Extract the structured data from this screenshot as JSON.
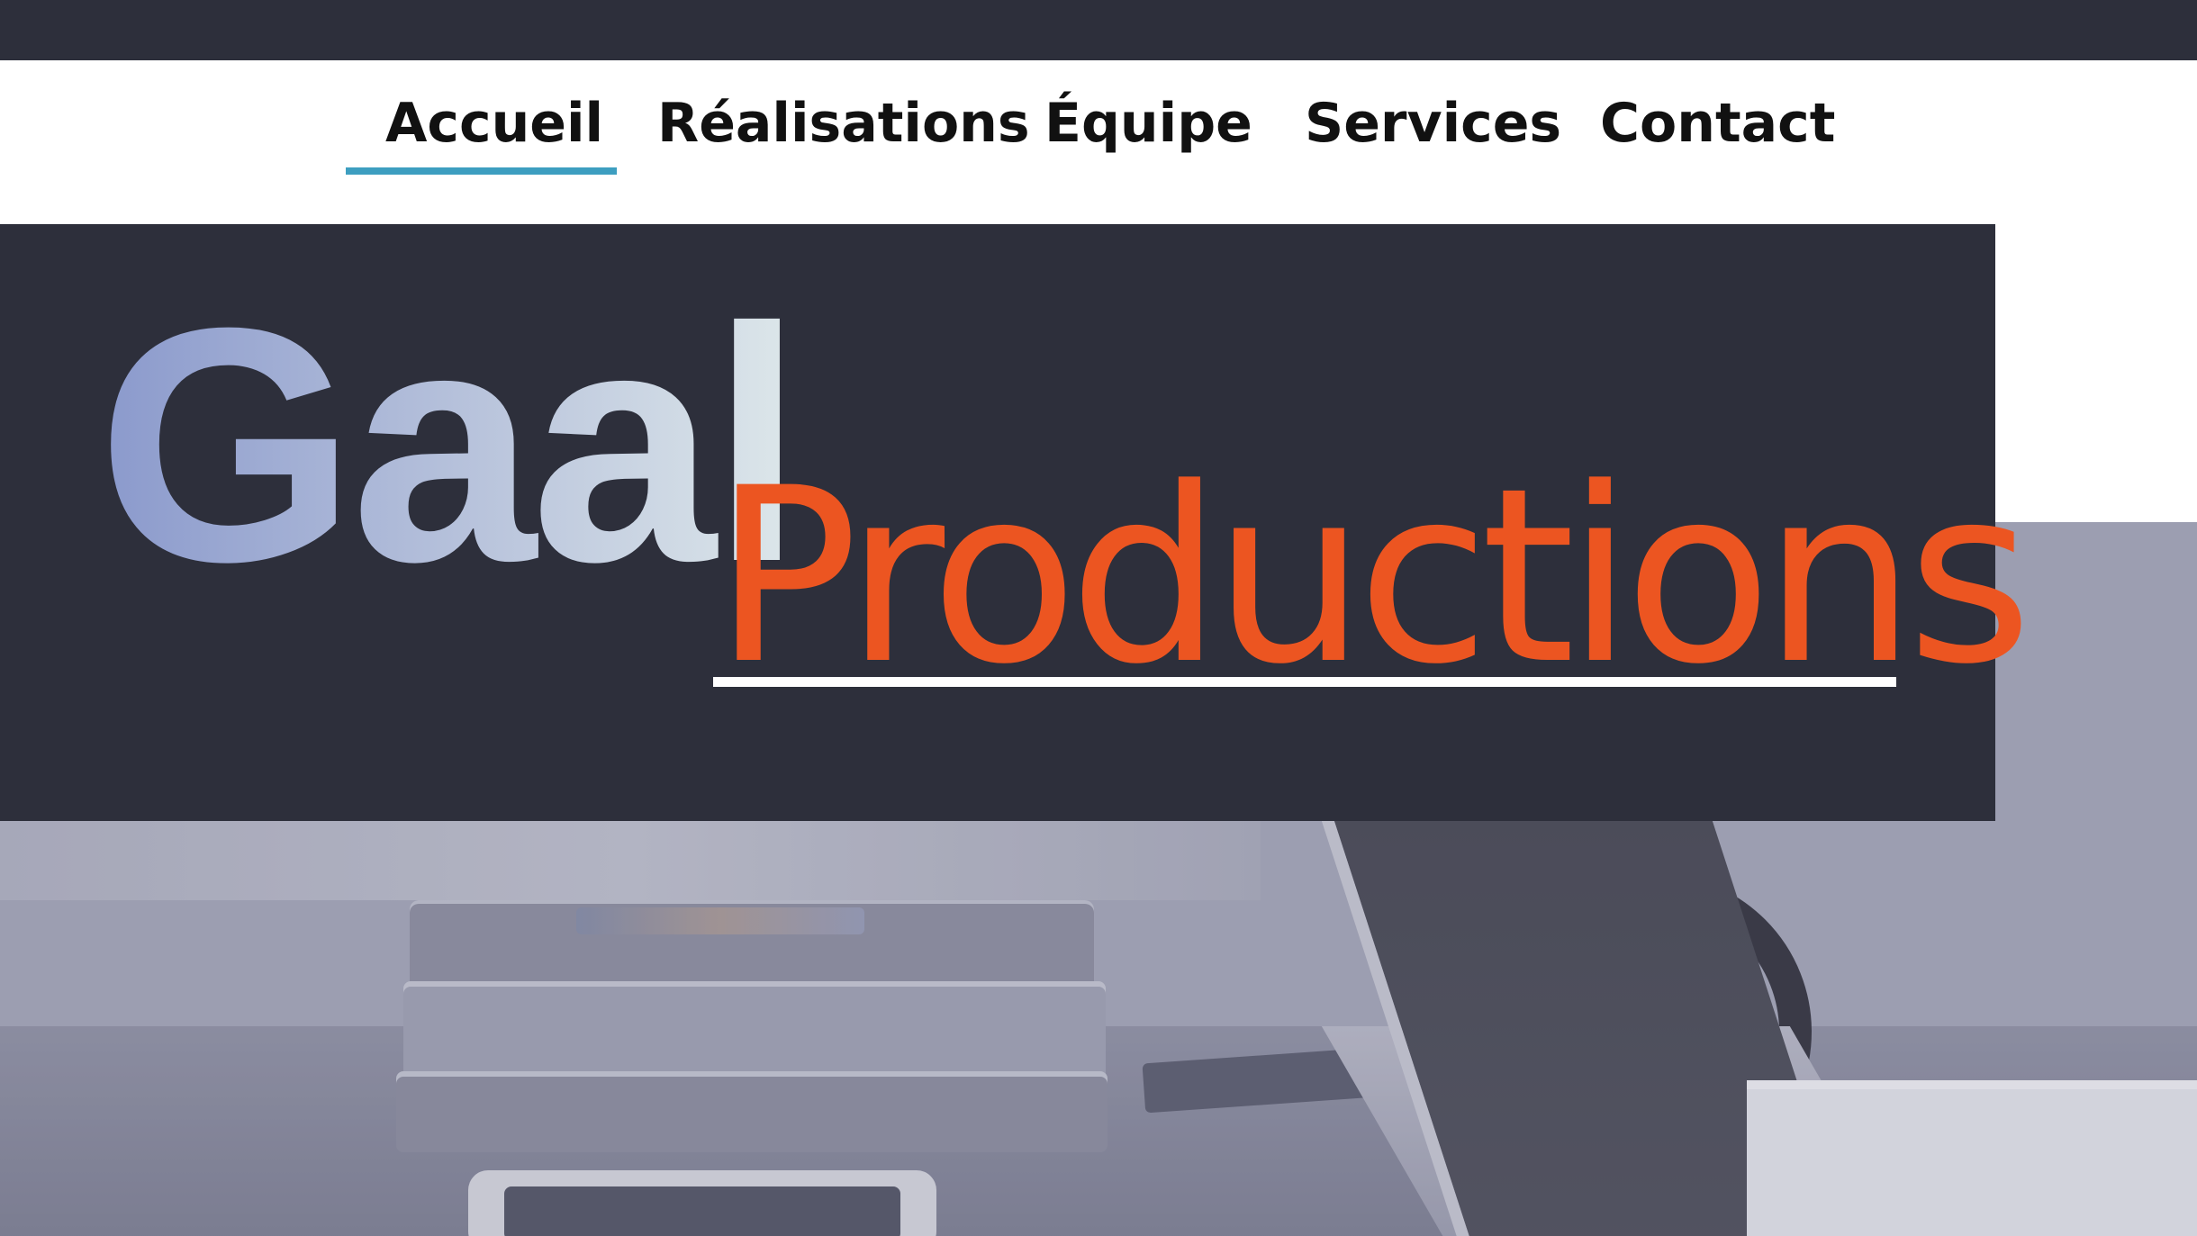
{
  "nav": {
    "items": [
      {
        "label": "Accueil",
        "active": true
      },
      {
        "label": "Réalisations",
        "active": false
      },
      {
        "label": "Équipe",
        "active": false
      },
      {
        "label": "Services",
        "active": false
      },
      {
        "label": "Contact",
        "active": false
      }
    ]
  },
  "hero": {
    "brand_primary": "Gaal",
    "brand_secondary": "Productions"
  },
  "colors": {
    "dark_bar": "#2d2f3b",
    "active_underline": "#3d9ec0",
    "brand_orange": "#ec5521",
    "brand_gradient_start": "#8a99cc",
    "brand_gradient_end": "#dde7ea"
  },
  "background_image": "desk-workspace-photo"
}
